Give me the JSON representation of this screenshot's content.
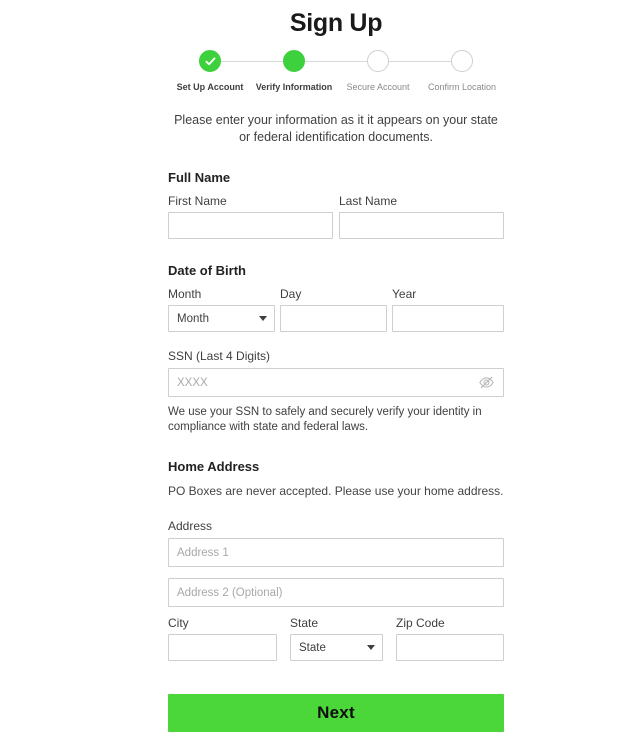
{
  "page": {
    "title": "Sign Up",
    "accent_green": "#4bd639",
    "step_green": "#3ed13e",
    "border_gray": "#cfcfcf",
    "intro": "Please enter your information as it it appears on your state or federal identification documents."
  },
  "stepper": {
    "steps": [
      {
        "label": "Set Up Account",
        "state": "done"
      },
      {
        "label": "Verify Information",
        "state": "active"
      },
      {
        "label": "Secure Account",
        "state": "pending"
      },
      {
        "label": "Confirm Location",
        "state": "pending"
      }
    ]
  },
  "full_name": {
    "section_title": "Full Name",
    "first": {
      "label": "First Name",
      "value": "",
      "placeholder": ""
    },
    "last": {
      "label": "Last Name",
      "value": "",
      "placeholder": ""
    }
  },
  "date_of_birth": {
    "section_title": "Date of Birth",
    "month": {
      "label": "Month",
      "selected": "Month",
      "options": [
        "Month"
      ]
    },
    "day": {
      "label": "Day",
      "value": "",
      "placeholder": ""
    },
    "year": {
      "label": "Year",
      "value": "",
      "placeholder": ""
    }
  },
  "ssn": {
    "label": "SSN (Last 4 Digits)",
    "value": "",
    "placeholder": "XXXX",
    "toggle_icon": "eye-slash-icon",
    "helper": "We use your SSN to safely and securely verify your identity in compliance with state and federal laws."
  },
  "home_address": {
    "section_title": "Home Address",
    "note": "PO Boxes are never accepted. Please use your home address.",
    "address_label": "Address",
    "address1": {
      "value": "",
      "placeholder": "Address 1"
    },
    "address2": {
      "value": "",
      "placeholder": "Address 2 (Optional)"
    },
    "city": {
      "label": "City",
      "value": "",
      "placeholder": ""
    },
    "state": {
      "label": "State",
      "selected": "State",
      "options": [
        "State"
      ]
    },
    "zip": {
      "label": "Zip Code",
      "value": "",
      "placeholder": ""
    }
  },
  "footer": {
    "next_label": "Next"
  }
}
